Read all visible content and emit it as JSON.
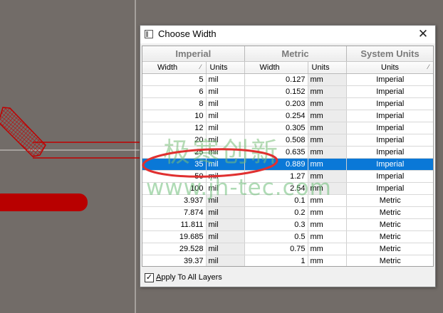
{
  "dialog": {
    "title": "Choose Width",
    "close_glyph": "✕",
    "icon": "window-icon"
  },
  "table": {
    "groups": [
      "Imperial",
      "Metric",
      "System Units"
    ],
    "subheaders": {
      "imperial_width": "Width",
      "imperial_units": "Units",
      "metric_width": "Width",
      "metric_units": "Units",
      "system_units": "Units"
    },
    "rows": [
      {
        "imp": "5",
        "imp_u": "mil",
        "met": "0.127",
        "met_u": "mm",
        "sys": "Imperial"
      },
      {
        "imp": "6",
        "imp_u": "mil",
        "met": "0.152",
        "met_u": "mm",
        "sys": "Imperial"
      },
      {
        "imp": "8",
        "imp_u": "mil",
        "met": "0.203",
        "met_u": "mm",
        "sys": "Imperial"
      },
      {
        "imp": "10",
        "imp_u": "mil",
        "met": "0.254",
        "met_u": "mm",
        "sys": "Imperial"
      },
      {
        "imp": "12",
        "imp_u": "mil",
        "met": "0.305",
        "met_u": "mm",
        "sys": "Imperial"
      },
      {
        "imp": "20",
        "imp_u": "mil",
        "met": "0.508",
        "met_u": "mm",
        "sys": "Imperial"
      },
      {
        "imp": "25",
        "imp_u": "mil",
        "met": "0.635",
        "met_u": "mm",
        "sys": "Imperial"
      },
      {
        "imp": "35",
        "imp_u": "mil",
        "met": "0.889",
        "met_u": "mm",
        "sys": "Imperial"
      },
      {
        "imp": "50",
        "imp_u": "mil",
        "met": "1.27",
        "met_u": "mm",
        "sys": "Imperial"
      },
      {
        "imp": "100",
        "imp_u": "mil",
        "met": "2.54",
        "met_u": "mm",
        "sys": "Imperial"
      },
      {
        "imp": "3.937",
        "imp_u": "mil",
        "met": "0.1",
        "met_u": "mm",
        "sys": "Metric"
      },
      {
        "imp": "7.874",
        "imp_u": "mil",
        "met": "0.2",
        "met_u": "mm",
        "sys": "Metric"
      },
      {
        "imp": "11.811",
        "imp_u": "mil",
        "met": "0.3",
        "met_u": "mm",
        "sys": "Metric"
      },
      {
        "imp": "19.685",
        "imp_u": "mil",
        "met": "0.5",
        "met_u": "mm",
        "sys": "Metric"
      },
      {
        "imp": "29.528",
        "imp_u": "mil",
        "met": "0.75",
        "met_u": "mm",
        "sys": "Metric"
      },
      {
        "imp": "39.37",
        "imp_u": "mil",
        "met": "1",
        "met_u": "mm",
        "sys": "Metric"
      }
    ],
    "selected_row_index": 7
  },
  "footer": {
    "apply_checked": true,
    "apply_label_accel": "A",
    "apply_label_rest": "pply To All Layers"
  },
  "watermark": {
    "cn_text": "极寒创新",
    "url_text": "www.jh-tec.com"
  },
  "colors": {
    "canvas_bg": "#726c68",
    "selection": "#0a78d7",
    "track_red": "#b80000",
    "annotation_red": "#e03030"
  }
}
